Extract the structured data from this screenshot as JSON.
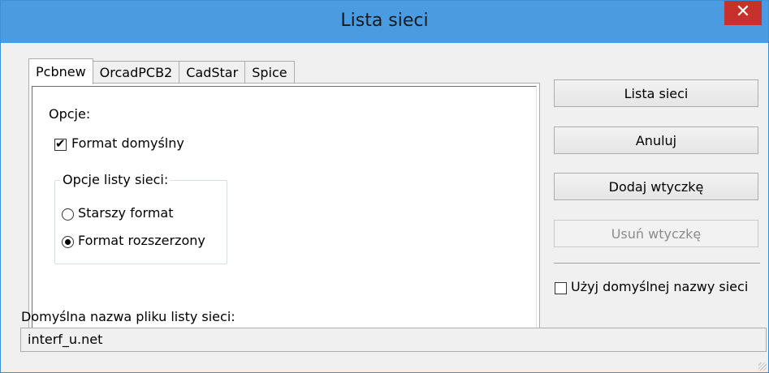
{
  "window": {
    "title": "Lista sieci",
    "close_glyph": "✕"
  },
  "tabs": [
    {
      "label": "Pcbnew",
      "active": true
    },
    {
      "label": "OrcadPCB2",
      "active": false
    },
    {
      "label": "CadStar",
      "active": false
    },
    {
      "label": "Spice",
      "active": false
    }
  ],
  "panel": {
    "options_label": "Opcje:",
    "default_format": {
      "label": "Format domyślny",
      "checked": true
    },
    "group_title": "Opcje listy sieci:",
    "radio_old": {
      "label": "Starszy format",
      "checked": false
    },
    "radio_ext": {
      "label": "Format rozszerzony",
      "checked": true
    }
  },
  "buttons": {
    "netlist": "Lista sieci",
    "cancel": "Anuluj",
    "add_plugin": "Dodaj wtyczkę",
    "remove_plugin": "Usuń wtyczkę"
  },
  "use_default_name": {
    "label": "Użyj domyślnej nazwy sieci",
    "checked": false
  },
  "filename": {
    "label": "Domyślna nazwa pliku listy sieci:",
    "value": "interf_u.net"
  },
  "colors": {
    "titlebar": "#4a9be0",
    "close": "#c7312b"
  }
}
